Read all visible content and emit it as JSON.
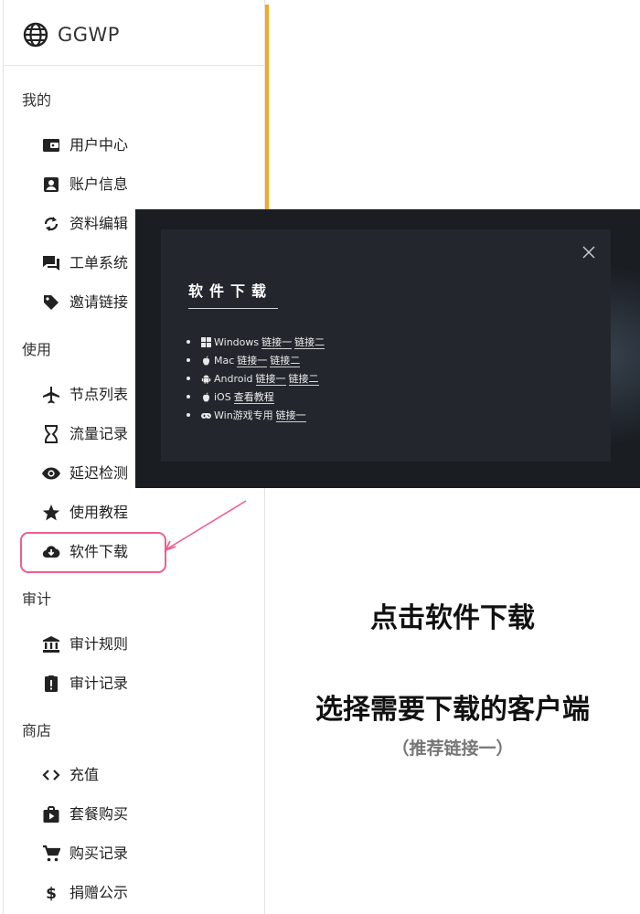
{
  "brand": {
    "name": "GGWP"
  },
  "sidebar": {
    "sections": [
      {
        "title": "我的",
        "items": [
          {
            "label": "用户中心",
            "icon": "wallet-icon"
          },
          {
            "label": "账户信息",
            "icon": "account-box-icon"
          },
          {
            "label": "资料编辑",
            "icon": "sync-icon"
          },
          {
            "label": "工单系统",
            "icon": "forum-icon"
          },
          {
            "label": "邀请链接",
            "icon": "tag-icon"
          }
        ]
      },
      {
        "title": "使用",
        "items": [
          {
            "label": "节点列表",
            "icon": "airplane-icon"
          },
          {
            "label": "流量记录",
            "icon": "hourglass-icon"
          },
          {
            "label": "延迟检测",
            "icon": "eye-icon"
          },
          {
            "label": "使用教程",
            "icon": "star-icon"
          },
          {
            "label": "软件下载",
            "icon": "cloud-download-icon"
          }
        ]
      },
      {
        "title": "审计",
        "items": [
          {
            "label": "审计规则",
            "icon": "bank-icon"
          },
          {
            "label": "审计记录",
            "icon": "report-icon"
          }
        ]
      },
      {
        "title": "商店",
        "items": [
          {
            "label": "充值",
            "icon": "code-icon"
          },
          {
            "label": "套餐购买",
            "icon": "shop-icon"
          },
          {
            "label": "购买记录",
            "icon": "cart-icon"
          },
          {
            "label": "捐赠公示",
            "icon": "dollar-icon"
          }
        ]
      }
    ]
  },
  "modal": {
    "title": "软件下载",
    "downloads": [
      {
        "icon": "windows-icon",
        "name": "Windows",
        "links": [
          "链接一",
          "链接二"
        ]
      },
      {
        "icon": "apple-icon",
        "name": "Mac",
        "links": [
          "链接一",
          "链接二"
        ]
      },
      {
        "icon": "android-icon",
        "name": "Android",
        "links": [
          "链接一",
          "链接二"
        ]
      },
      {
        "icon": "apple-icon",
        "name": "iOS",
        "links": [
          "查看教程"
        ]
      },
      {
        "icon": "gamepad-icon",
        "name": "Win游戏专用",
        "links": [
          "链接一"
        ]
      }
    ]
  },
  "instructions": {
    "step1": "点击软件下载",
    "step2": "选择需要下载的客户端",
    "note": "（推荐链接一）"
  },
  "colors": {
    "accent_bar": "#f5a623",
    "highlight": "#ee5f8d",
    "modal_bg": "#23272d"
  }
}
